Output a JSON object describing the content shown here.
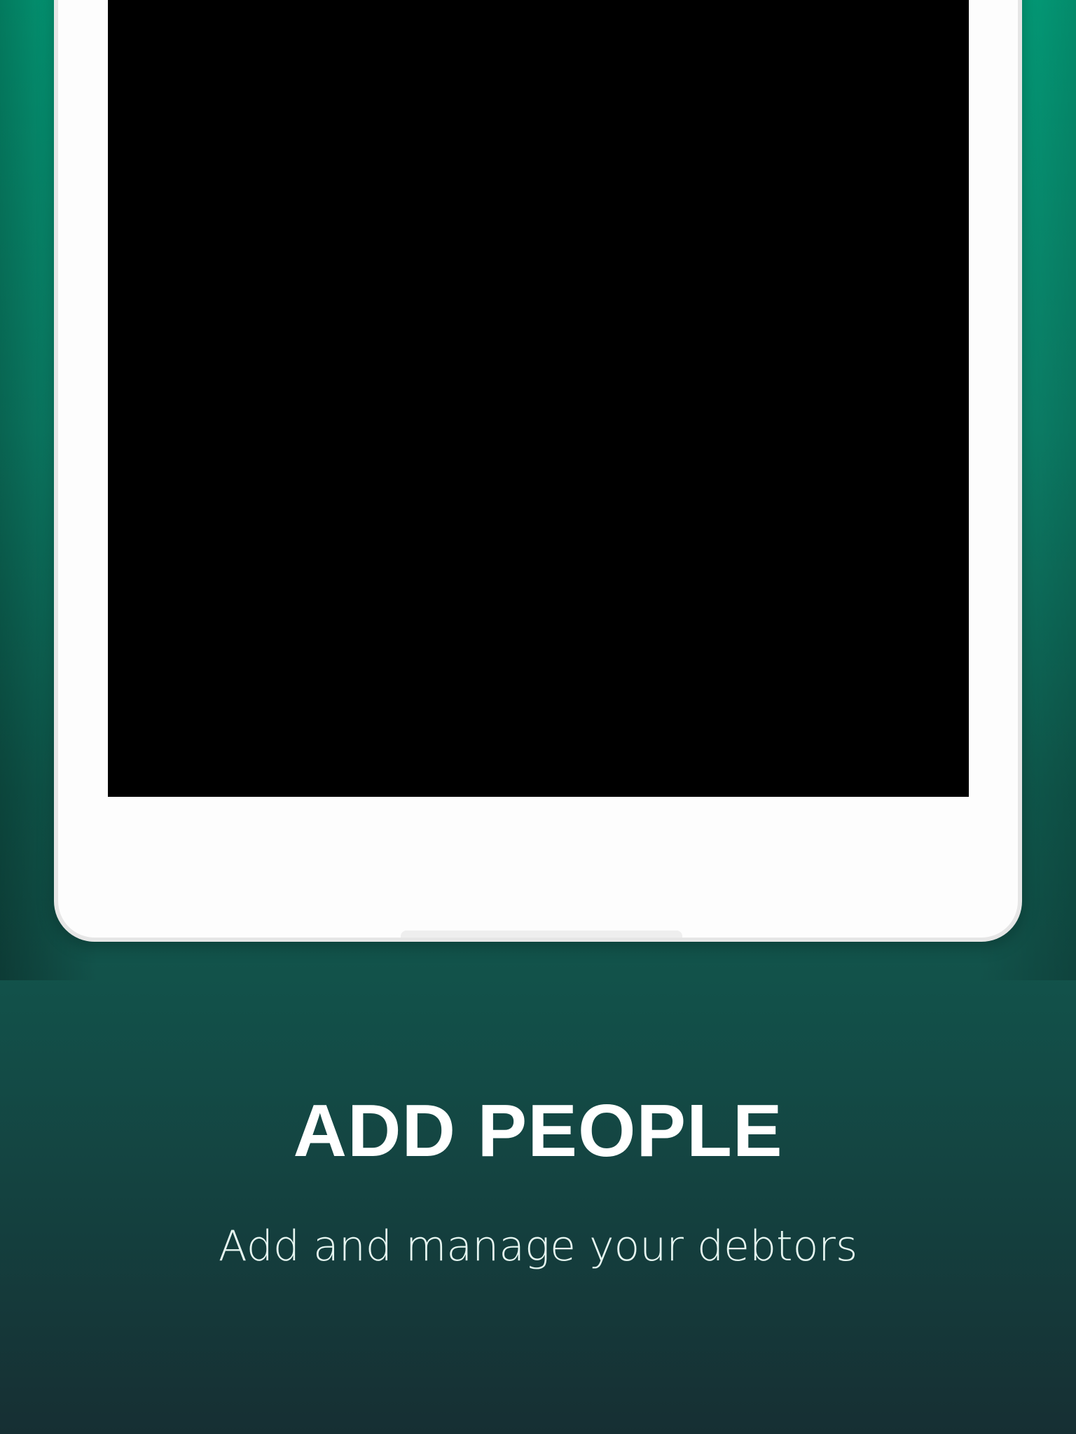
{
  "headline": "ADD PEOPLE",
  "subtitle": "Add and manage your debtors",
  "colors": {
    "background_top": "#04a982",
    "background_bottom": "#162f33",
    "device_frame": "#fdfdfd",
    "screen": "#000000",
    "text_primary": "#ffffff"
  }
}
